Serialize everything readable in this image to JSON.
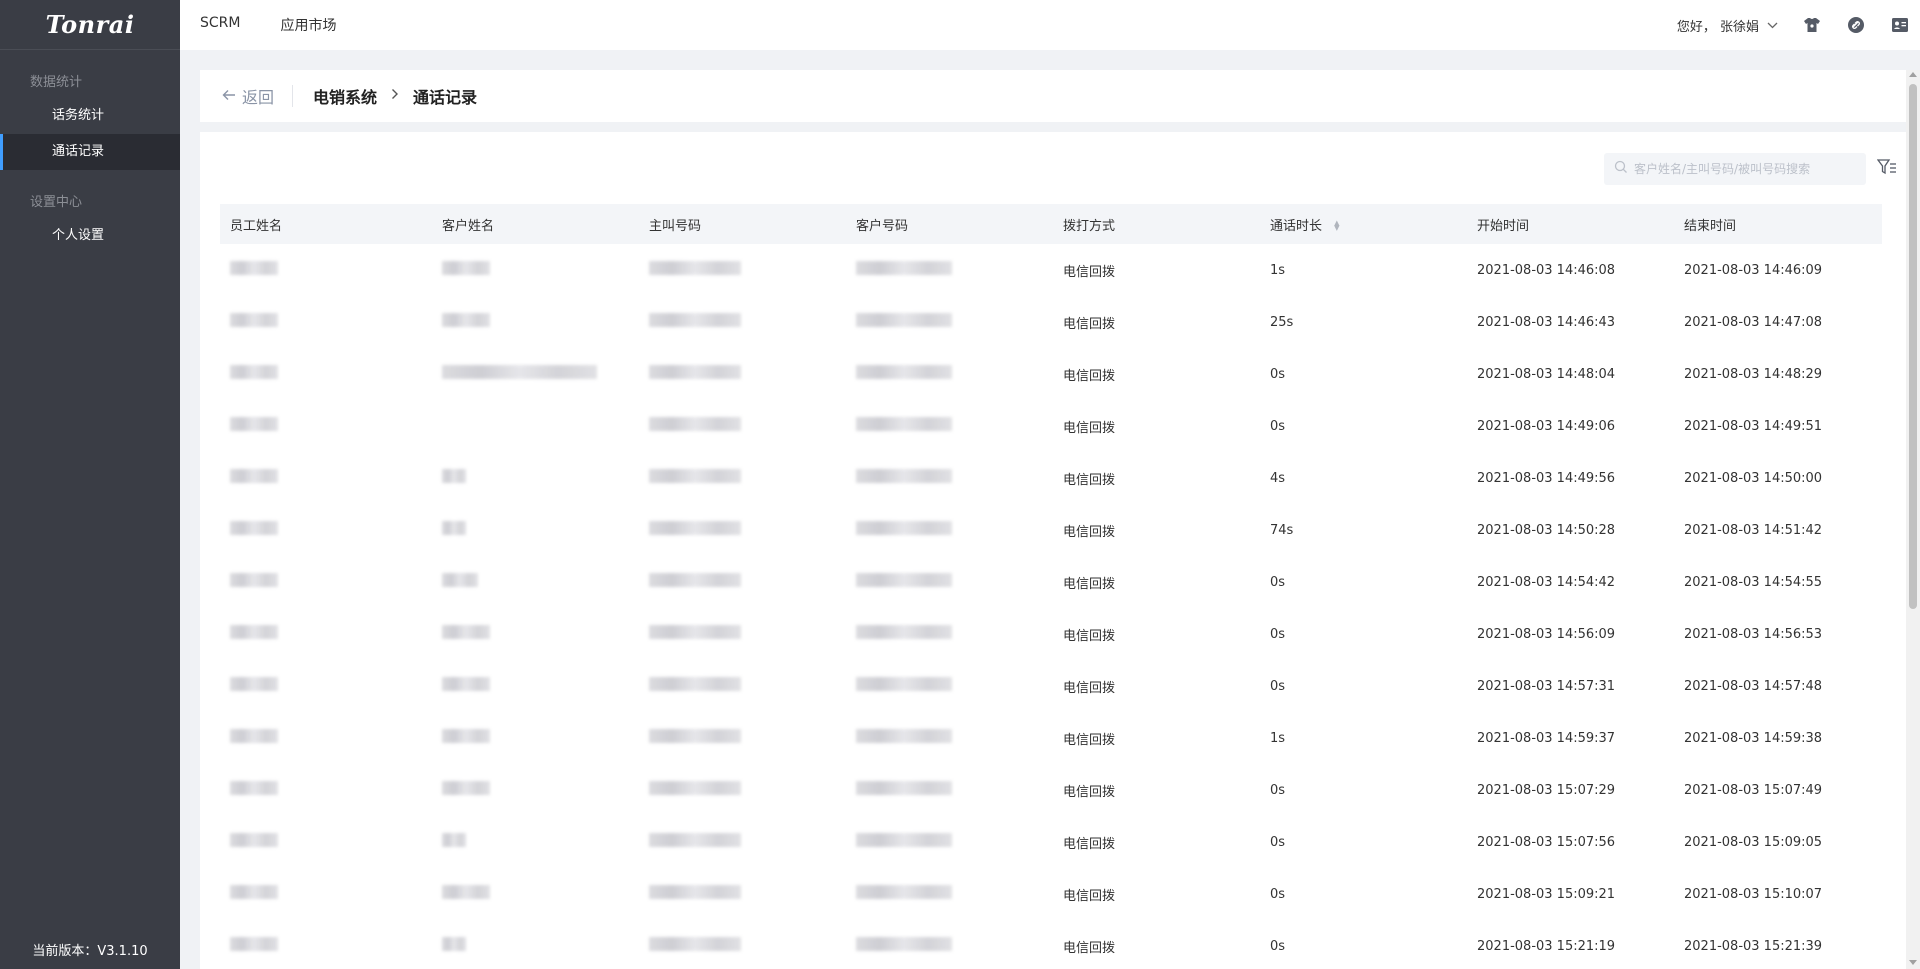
{
  "sidebar": {
    "logo": "Tonrai",
    "groups": [
      {
        "title": "数据统计",
        "items": [
          {
            "label": "话务统计"
          },
          {
            "label": "通话记录"
          }
        ]
      },
      {
        "title": "设置中心",
        "items": [
          {
            "label": "个人设置"
          }
        ]
      }
    ],
    "version": "当前版本：V3.1.10"
  },
  "topbar": {
    "nav": [
      {
        "label": "SCRM"
      },
      {
        "label": "应用市场"
      }
    ],
    "greeting": "您好， 张徐娟",
    "icons": [
      "tshirt-icon",
      "link-icon",
      "contact-card-icon"
    ]
  },
  "breadcrumb": {
    "back": "返回",
    "items": [
      "电销系统",
      "通话记录"
    ]
  },
  "search": {
    "placeholder": "客户姓名/主叫号码/被叫号码搜索"
  },
  "table": {
    "columns": [
      "员工姓名",
      "客户姓名",
      "主叫号码",
      "客户号码",
      "拨打方式",
      "通话时长",
      "开始时间",
      "结束时间"
    ],
    "rows": [
      {
        "method": "电信回拨",
        "duration": "1s",
        "start": "2021-08-03 14:46:08",
        "end": "2021-08-03 14:46:09"
      },
      {
        "method": "电信回拨",
        "duration": "25s",
        "start": "2021-08-03 14:46:43",
        "end": "2021-08-03 14:47:08"
      },
      {
        "method": "电信回拨",
        "duration": "0s",
        "start": "2021-08-03 14:48:04",
        "end": "2021-08-03 14:48:29"
      },
      {
        "method": "电信回拨",
        "duration": "0s",
        "start": "2021-08-03 14:49:06",
        "end": "2021-08-03 14:49:51"
      },
      {
        "method": "电信回拨",
        "duration": "4s",
        "start": "2021-08-03 14:49:56",
        "end": "2021-08-03 14:50:00"
      },
      {
        "method": "电信回拨",
        "duration": "74s",
        "start": "2021-08-03 14:50:28",
        "end": "2021-08-03 14:51:42"
      },
      {
        "method": "电信回拨",
        "duration": "0s",
        "start": "2021-08-03 14:54:42",
        "end": "2021-08-03 14:54:55"
      },
      {
        "method": "电信回拨",
        "duration": "0s",
        "start": "2021-08-03 14:56:09",
        "end": "2021-08-03 14:56:53"
      },
      {
        "method": "电信回拨",
        "duration": "0s",
        "start": "2021-08-03 14:57:31",
        "end": "2021-08-03 14:57:48"
      },
      {
        "method": "电信回拨",
        "duration": "1s",
        "start": "2021-08-03 14:59:37",
        "end": "2021-08-03 14:59:38"
      },
      {
        "method": "电信回拨",
        "duration": "0s",
        "start": "2021-08-03 15:07:29",
        "end": "2021-08-03 15:07:49"
      },
      {
        "method": "电信回拨",
        "duration": "0s",
        "start": "2021-08-03 15:07:56",
        "end": "2021-08-03 15:09:05"
      },
      {
        "method": "电信回拨",
        "duration": "0s",
        "start": "2021-08-03 15:09:21",
        "end": "2021-08-03 15:10:07"
      },
      {
        "method": "电信回拨",
        "duration": "0s",
        "start": "2021-08-03 15:21:19",
        "end": "2021-08-03 15:21:39"
      }
    ]
  },
  "colors": {
    "sidebar_bg": "#3a3d45",
    "active_accent": "#409eff",
    "page_bg": "#f0f2f5"
  }
}
